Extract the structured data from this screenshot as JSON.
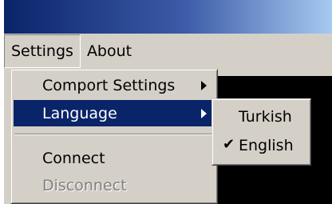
{
  "menubar": {
    "items": [
      {
        "label": "Settings"
      },
      {
        "label": "About"
      }
    ]
  },
  "settings_menu": {
    "comport_settings": "Comport Settings",
    "language": "Language",
    "connect": "Connect",
    "disconnect": "Disconnect"
  },
  "language_menu": {
    "items": [
      {
        "label": "Turkish",
        "checked": false
      },
      {
        "label": "English",
        "checked": true
      }
    ]
  },
  "icons": {
    "submenu_arrow": "submenu-arrow-icon",
    "check": "checkmark-icon"
  },
  "colors": {
    "highlight": "#0a246a",
    "menu_bg": "#d4d0c8",
    "disabled_text": "#808080"
  }
}
